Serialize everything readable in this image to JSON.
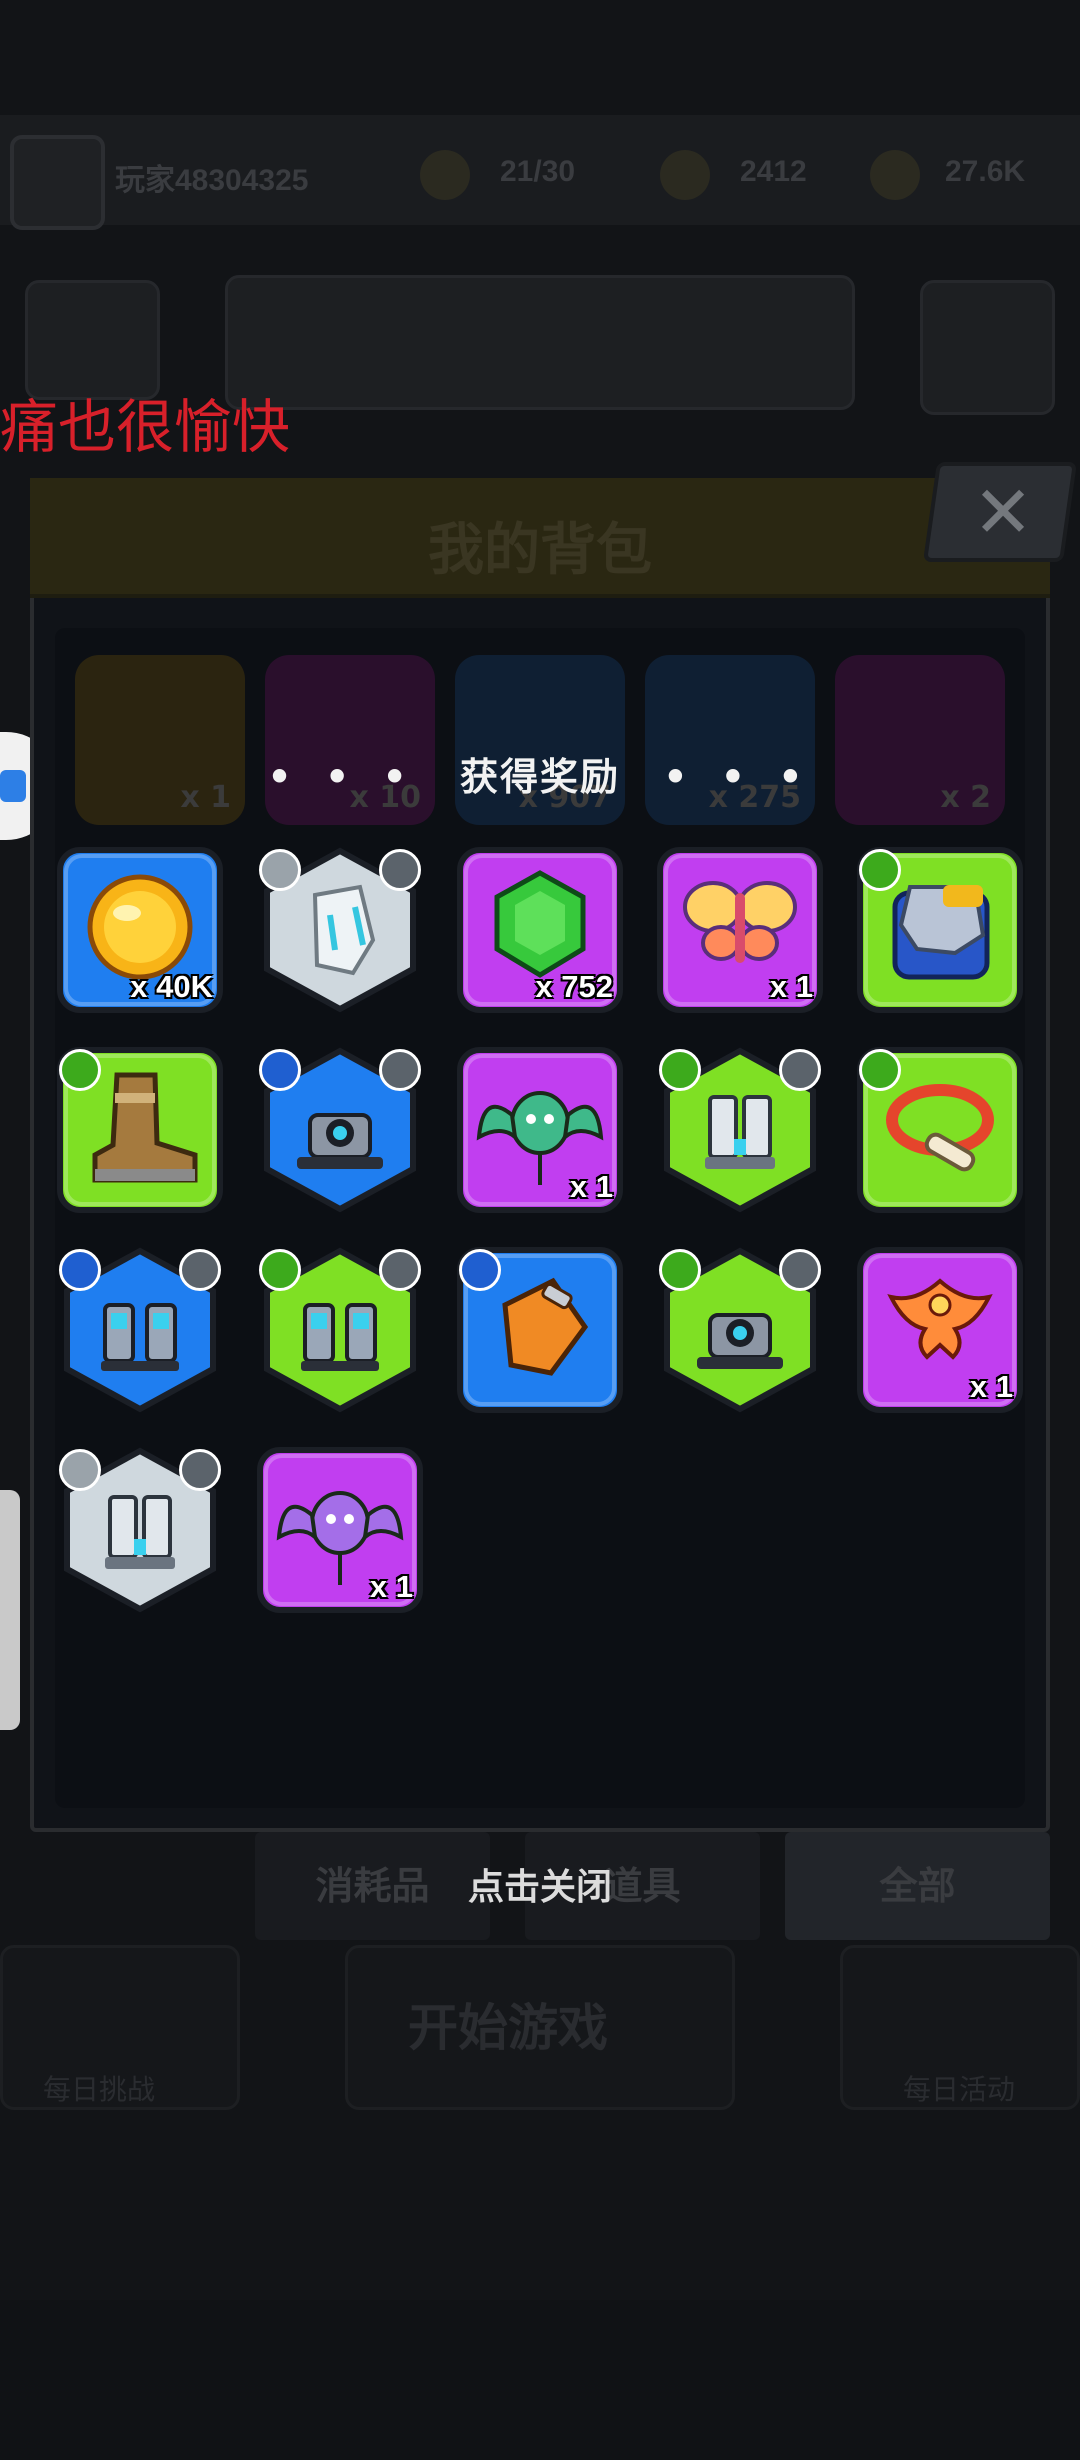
{
  "overlay_caption": "痛也很愉快",
  "hud": {
    "player_id": "玩家48304325",
    "energy": "21/30",
    "gems": "2412",
    "gold": "27.6K"
  },
  "panel": {
    "title": "我的背包",
    "close_symbol": "✕"
  },
  "background_items": [
    {
      "icon": "dna-icon",
      "count": "x 1",
      "color": "#2b2410"
    },
    {
      "icon": "heart-icon",
      "count": "x 10",
      "color": "#2a0f2c"
    },
    {
      "icon": "flame-icon",
      "count": "x 907",
      "color": "#0f1f33"
    },
    {
      "icon": "box-icon",
      "count": "x 275",
      "color": "#0f1f33"
    },
    {
      "icon": "puzzle-icon",
      "count": "x 2",
      "color": "#2a0f2c"
    }
  ],
  "reward_popup": {
    "dots_left": "• • •",
    "title": "获得奖励",
    "dots_right": "• • •",
    "items": [
      {
        "name": "gold-coin",
        "shape": "square",
        "bg": "#1f7ef0",
        "count": "x 40K",
        "icon": "coin-icon"
      },
      {
        "name": "steel-plate",
        "shape": "hex",
        "bg": "#cfd8de",
        "count": "",
        "icon": "plate-icon",
        "badge_left": "shield-badge",
        "badge_right": "drill-badge"
      },
      {
        "name": "green-gem",
        "shape": "square",
        "bg": "#c13ef0",
        "count": "x 752",
        "icon": "gem-icon"
      },
      {
        "name": "butterfly",
        "shape": "square",
        "bg": "#c13ef0",
        "count": "x 1",
        "icon": "butterfly-icon"
      },
      {
        "name": "armor-chest",
        "shape": "square",
        "bg": "#7fe024",
        "count": "",
        "icon": "armor-icon",
        "badge_left": "shirt-badge"
      },
      {
        "name": "combat-boot",
        "shape": "square",
        "bg": "#7fe024",
        "count": "",
        "icon": "boot-icon",
        "badge_left": "book-badge"
      },
      {
        "name": "blue-scanner",
        "shape": "hex",
        "bg": "#1f7ef0",
        "count": "",
        "icon": "scanner-icon",
        "badge_left": "arrow-badge",
        "badge_right": "drill-badge"
      },
      {
        "name": "green-bat-kite",
        "shape": "square",
        "bg": "#c13ef0",
        "count": "x 1",
        "icon": "bat-icon"
      },
      {
        "name": "green-canisters",
        "shape": "hex",
        "bg": "#7fe024",
        "count": "",
        "icon": "canister-icon",
        "badge_left": "shield-badge",
        "badge_right": "ingot-badge"
      },
      {
        "name": "bone-ring",
        "shape": "square",
        "bg": "#7fe024",
        "count": "",
        "icon": "ring-icon",
        "badge_left": "necklace-badge"
      },
      {
        "name": "blue-boosters",
        "shape": "hex",
        "bg": "#1f7ef0",
        "count": "",
        "icon": "booster-icon",
        "badge_left": "arrow-badge",
        "badge_right": "drill-badge"
      },
      {
        "name": "green-boosters",
        "shape": "hex",
        "bg": "#7fe024",
        "count": "",
        "icon": "booster-icon",
        "badge_left": "arrow-badge",
        "badge_right": "drill-badge"
      },
      {
        "name": "orange-glove",
        "shape": "square",
        "bg": "#1f7ef0",
        "count": "",
        "icon": "glove-icon",
        "badge_left": "hand-badge"
      },
      {
        "name": "green-scanner",
        "shape": "hex",
        "bg": "#7fe024",
        "count": "",
        "icon": "scanner-icon",
        "badge_left": "arrow-badge",
        "badge_right": "drill-badge"
      },
      {
        "name": "phoenix-kite",
        "shape": "square",
        "bg": "#c13ef0",
        "count": "x 1",
        "icon": "phoenix-icon"
      },
      {
        "name": "grey-canisters",
        "shape": "hex",
        "bg": "#cfd8de",
        "count": "",
        "icon": "canister-icon",
        "badge_left": "shield-badge",
        "badge_right": "ingot-badge"
      },
      {
        "name": "purple-bat-kite",
        "shape": "square",
        "bg": "#c13ef0",
        "count": "x 1",
        "icon": "bat-icon"
      }
    ]
  },
  "tabs": {
    "consumables": "消耗品",
    "items": "道具",
    "all": "全部"
  },
  "close_hint": "点击关闭",
  "bottom": {
    "left_label": "每日挑战",
    "start_label": "开始游戏",
    "right_label": "每日活动"
  }
}
